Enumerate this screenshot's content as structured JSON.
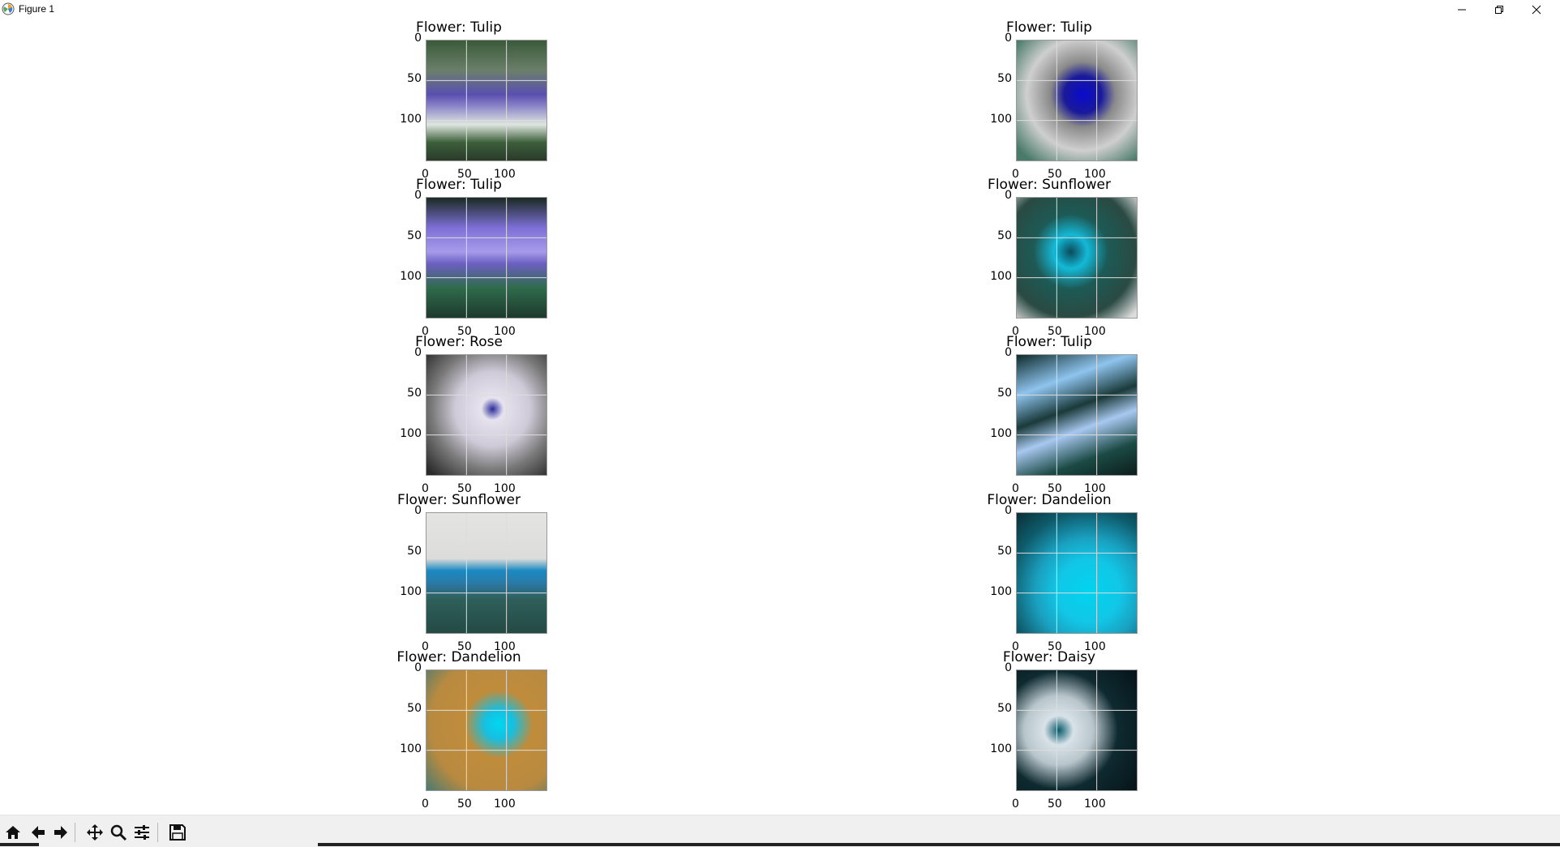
{
  "window": {
    "title": "Figure 1",
    "icons": [
      "app-icon",
      "minimize-icon",
      "restore-icon",
      "close-icon"
    ]
  },
  "figure": {
    "panels": [
      {
        "title": "Flower: Tulip"
      },
      {
        "title": "Flower: Tulip"
      },
      {
        "title": "Flower: Tulip"
      },
      {
        "title": "Flower: Sunflower"
      },
      {
        "title": "Flower: Rose"
      },
      {
        "title": "Flower: Tulip"
      },
      {
        "title": "Flower: Sunflower"
      },
      {
        "title": "Flower: Dandelion"
      },
      {
        "title": "Flower: Dandelion"
      },
      {
        "title": "Flower: Daisy"
      }
    ],
    "yticks": [
      "0",
      "50",
      "100"
    ],
    "xticks": [
      "0",
      "50",
      "100"
    ]
  },
  "toolbar": {
    "buttons": [
      "home-icon",
      "back-icon",
      "forward-icon",
      "pan-icon",
      "zoom-icon",
      "configure-subplots-icon",
      "save-icon"
    ]
  }
}
